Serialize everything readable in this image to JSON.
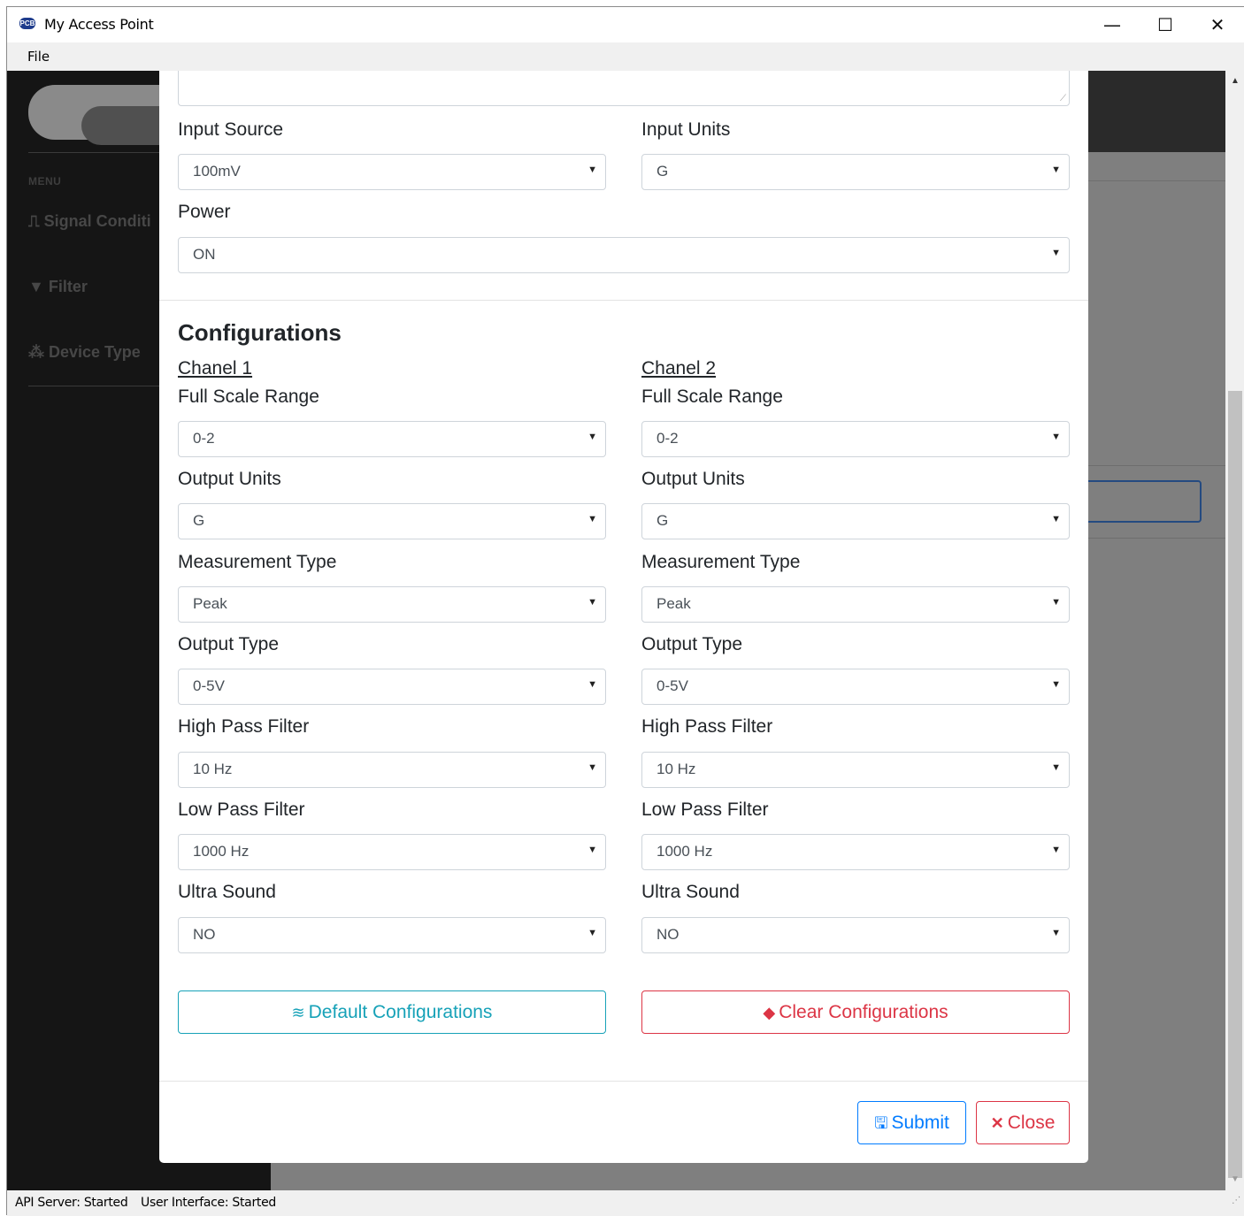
{
  "window": {
    "title": "My Access Point",
    "app_icon_text": "PCB",
    "minimize": "—",
    "maximize": "☐",
    "close": "✕"
  },
  "menubar": {
    "file": "File"
  },
  "sidebar": {
    "menu_label": "MENU",
    "items": [
      {
        "icon": "signal-icon",
        "label": "Signal Conditi"
      },
      {
        "icon": "filter-icon",
        "label": "Filter"
      },
      {
        "icon": "device-type-icon",
        "label": "Device Type"
      }
    ]
  },
  "modal": {
    "input_source": {
      "label": "Input Source",
      "value": "100mV"
    },
    "input_units": {
      "label": "Input Units",
      "value": "G"
    },
    "power": {
      "label": "Power",
      "value": "ON"
    },
    "configurations_title": "Configurations",
    "channels": [
      {
        "name": "Chanel 1",
        "full_scale_range": {
          "label": "Full Scale Range",
          "value": "0-2"
        },
        "output_units": {
          "label": "Output Units",
          "value": "G"
        },
        "measurement_type": {
          "label": "Measurement Type",
          "value": "Peak"
        },
        "output_type": {
          "label": "Output Type",
          "value": "0-5V"
        },
        "high_pass_filter": {
          "label": "High Pass Filter",
          "value": "10 Hz"
        },
        "low_pass_filter": {
          "label": "Low Pass Filter",
          "value": "1000 Hz"
        },
        "ultra_sound": {
          "label": "Ultra Sound",
          "value": "NO"
        }
      },
      {
        "name": "Chanel 2",
        "full_scale_range": {
          "label": "Full Scale Range",
          "value": "0-2"
        },
        "output_units": {
          "label": "Output Units",
          "value": "G"
        },
        "measurement_type": {
          "label": "Measurement Type",
          "value": "Peak"
        },
        "output_type": {
          "label": "Output Type",
          "value": "0-5V"
        },
        "high_pass_filter": {
          "label": "High Pass Filter",
          "value": "10 Hz"
        },
        "low_pass_filter": {
          "label": "Low Pass Filter",
          "value": "1000 Hz"
        },
        "ultra_sound": {
          "label": "Ultra Sound",
          "value": "NO"
        }
      }
    ],
    "default_button": "Default Configurations",
    "clear_button": "Clear Configurations",
    "submit_button": "Submit",
    "close_button": "Close",
    "colors": {
      "info": "#17a2b8",
      "danger": "#dc3545",
      "primary": "#007bff"
    }
  },
  "statusbar": {
    "api_server": "API Server: Started",
    "user_interface": "User Interface: Started"
  }
}
